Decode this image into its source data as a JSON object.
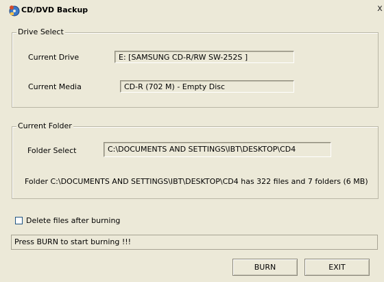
{
  "window": {
    "title": "CD/DVD Backup",
    "title_icon": "cd-dvd-backup-app-icon",
    "close_glyph": "x"
  },
  "drive_select": {
    "legend": "Drive Select",
    "current_drive_label": "Current Drive",
    "current_drive_value": "E: [SAMSUNG  CD-R/RW SW-252S ]",
    "current_media_label": "Current Media",
    "current_media_value": "CD-R (702 M) -  Empty Disc"
  },
  "current_folder": {
    "legend": "Current Folder",
    "folder_select_label": "Folder Select",
    "folder_select_value": "C:\\DOCUMENTS AND SETTINGS\\IBT\\DESKTOP\\CD4",
    "folder_info": "Folder C:\\DOCUMENTS AND SETTINGS\\IBT\\DESKTOP\\CD4 has 322 files and 7 folders (6 MB)"
  },
  "options": {
    "delete_after_burning_label": "Delete files after burning",
    "delete_after_burning_checked": false
  },
  "status": {
    "text": "Press BURN to start burning !!!"
  },
  "buttons": {
    "burn_label": "BURN",
    "exit_label": "EXIT"
  }
}
